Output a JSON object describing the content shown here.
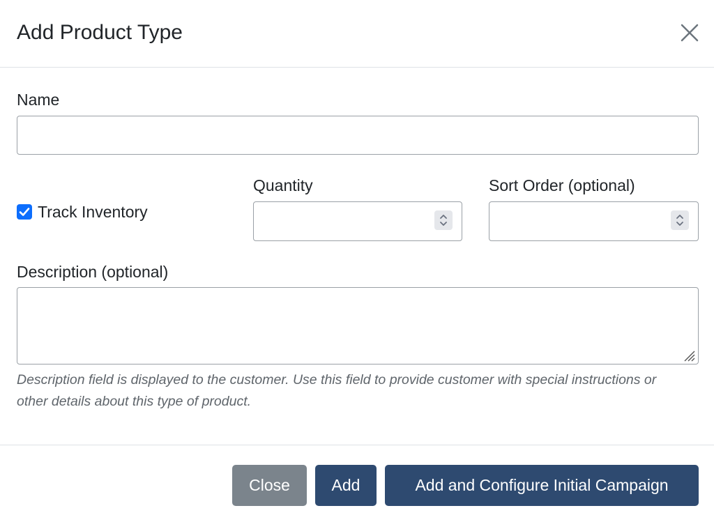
{
  "modal": {
    "title": "Add Product Type",
    "close_icon": "close-x-icon"
  },
  "form": {
    "name": {
      "label": "Name",
      "value": "",
      "placeholder": ""
    },
    "track_inventory": {
      "label": "Track Inventory",
      "checked": true
    },
    "quantity": {
      "label": "Quantity",
      "value": ""
    },
    "sort_order": {
      "label": "Sort Order (optional)",
      "value": ""
    },
    "description": {
      "label": "Description (optional)",
      "value": "",
      "help": "Description field is displayed to the customer. Use this field to provide customer with special instructions or other details about this type of product."
    }
  },
  "footer": {
    "close_label": "Close",
    "add_label": "Add",
    "add_configure_label": "Add and Configure Initial Campaign"
  },
  "colors": {
    "primary": "#2e4a70",
    "secondary": "#7b848c",
    "checkbox": "#0d6efd"
  }
}
